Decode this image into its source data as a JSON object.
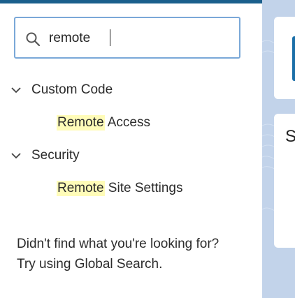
{
  "search": {
    "value": "remote",
    "icon": "search-icon"
  },
  "groups": [
    {
      "label": "Custom Code",
      "icon": "chevron-down-icon",
      "items": [
        {
          "highlight": "Remote",
          "rest": " Access"
        }
      ]
    },
    {
      "label": "Security",
      "icon": "chevron-down-icon",
      "items": [
        {
          "highlight": "Remote",
          "rest": " Site Settings"
        }
      ]
    }
  ],
  "not_found": {
    "line1": "Didn't find what you're looking for?",
    "line2": "Try using Global Search."
  },
  "background_card": {
    "letter": "S"
  },
  "colors": {
    "highlight": "#fffcb8",
    "search_border": "#7aa8d8",
    "right_background": "#c2d3ea",
    "top_strip": "#1b5f8c"
  }
}
